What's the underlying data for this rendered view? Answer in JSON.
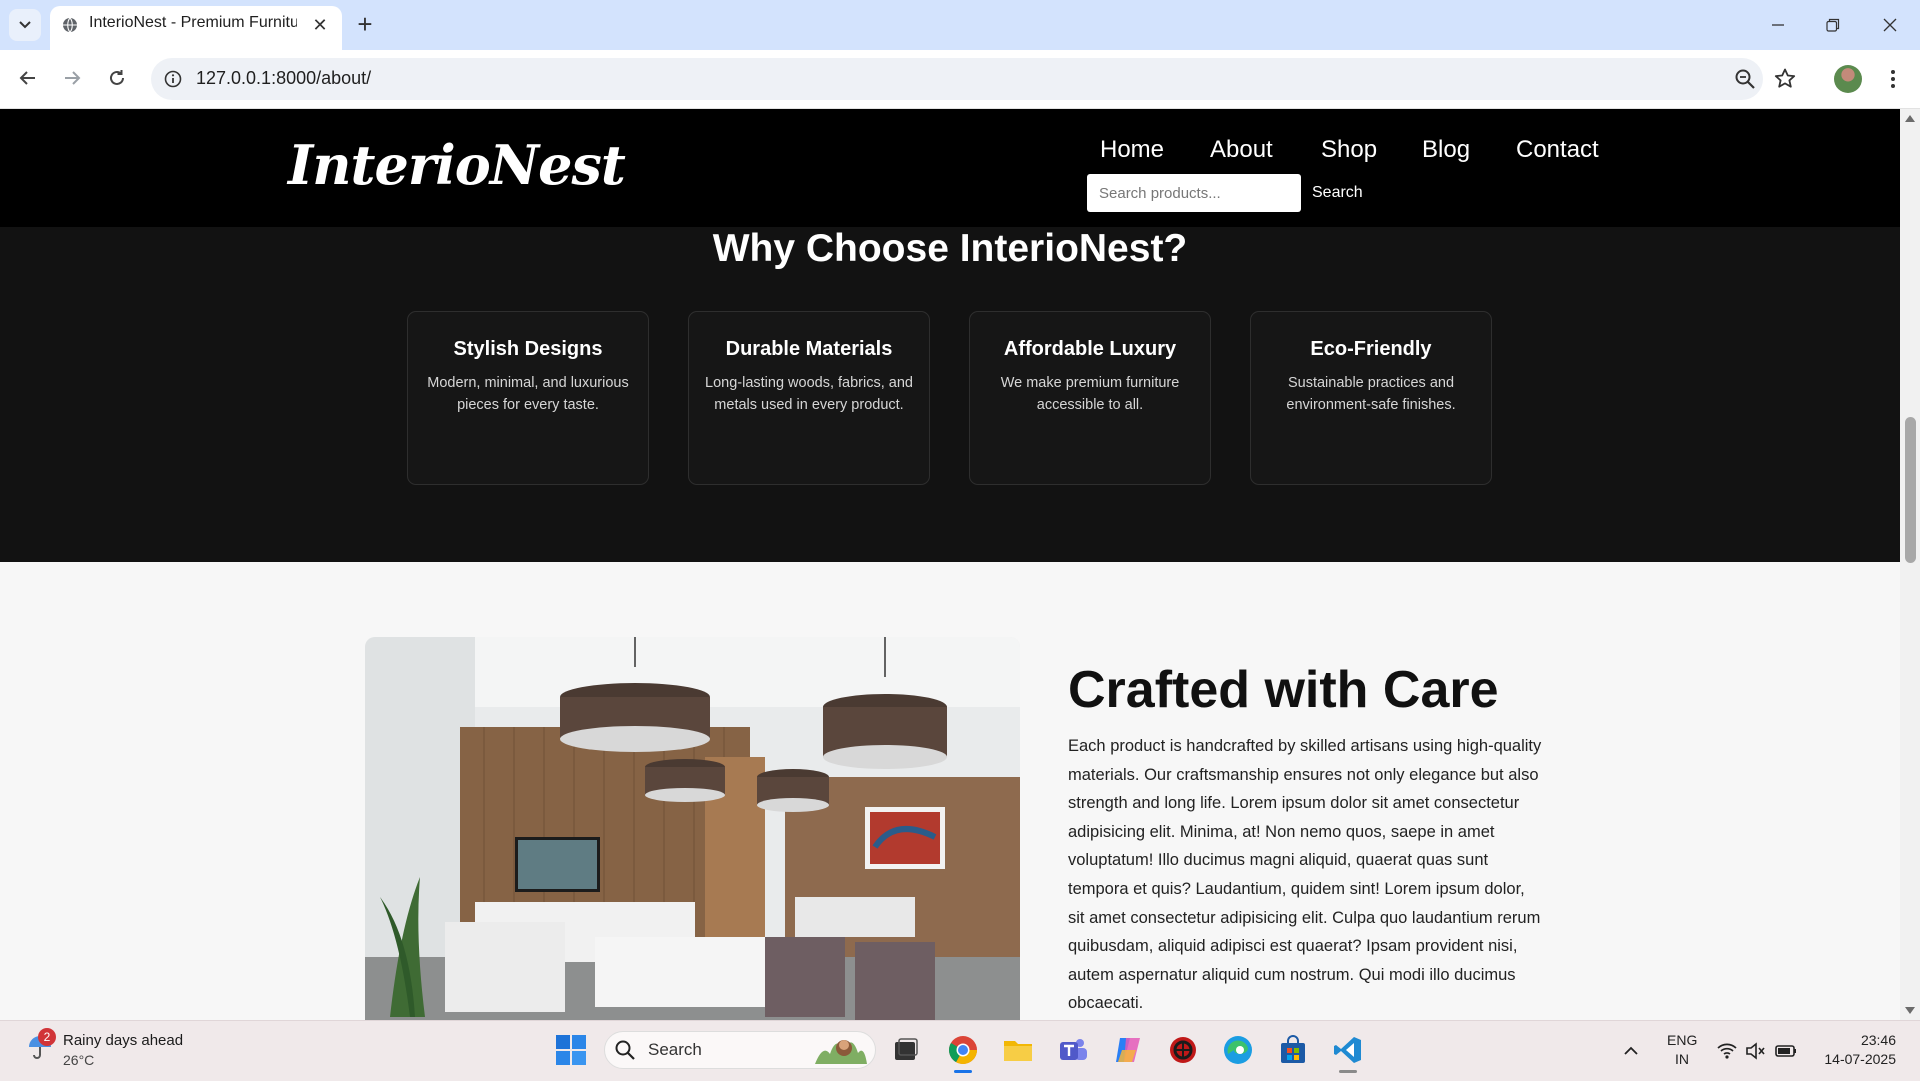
{
  "browser": {
    "tab_title": "InterioNest - Premium Furniture",
    "tab_close": "✕",
    "new_tab": "+",
    "url": "127.0.0.1:8000/about/"
  },
  "site": {
    "logo": "InterioNest",
    "nav": [
      "Home",
      "About",
      "Shop",
      "Blog",
      "Contact"
    ],
    "search_placeholder": "Search products...",
    "search_button": "Search"
  },
  "why": {
    "title": "Why Choose InterioNest?",
    "cards": [
      {
        "title": "Stylish Designs",
        "text": "Modern, minimal, and luxurious pieces for every taste."
      },
      {
        "title": "Durable Materials",
        "text": "Long-lasting woods, fabrics, and metals used in every product."
      },
      {
        "title": "Affordable Luxury",
        "text": "We make premium furniture accessible to all."
      },
      {
        "title": "Eco-Friendly",
        "text": "Sustainable practices and environment-safe finishes."
      }
    ]
  },
  "craft": {
    "title": "Crafted with Care",
    "text": "Each product is handcrafted by skilled artisans using high-quality materials. Our craftsmanship ensures not only elegance but also strength and long life. Lorem ipsum dolor sit amet consectetur adipisicing elit. Minima, at! Non nemo quos, saepe in amet voluptatum! Illo ducimus magni aliquid, quaerat quas sunt tempora et quis? Laudantium, quidem sint! Lorem ipsum dolor, sit amet consectetur adipisicing elit. Culpa quo laudantium rerum quibusdam, aliquid adipisci est quaerat? Ipsam provident nisi, autem aspernatur aliquid cum nostrum. Qui modi illo ducimus obcaecati."
  },
  "taskbar": {
    "weather_badge": "2",
    "weather_title": "Rainy days ahead",
    "weather_temp": "26°C",
    "search_label": "Search",
    "lang_line1": "ENG",
    "lang_line2": "IN",
    "time": "23:46",
    "date": "14-07-2025"
  }
}
